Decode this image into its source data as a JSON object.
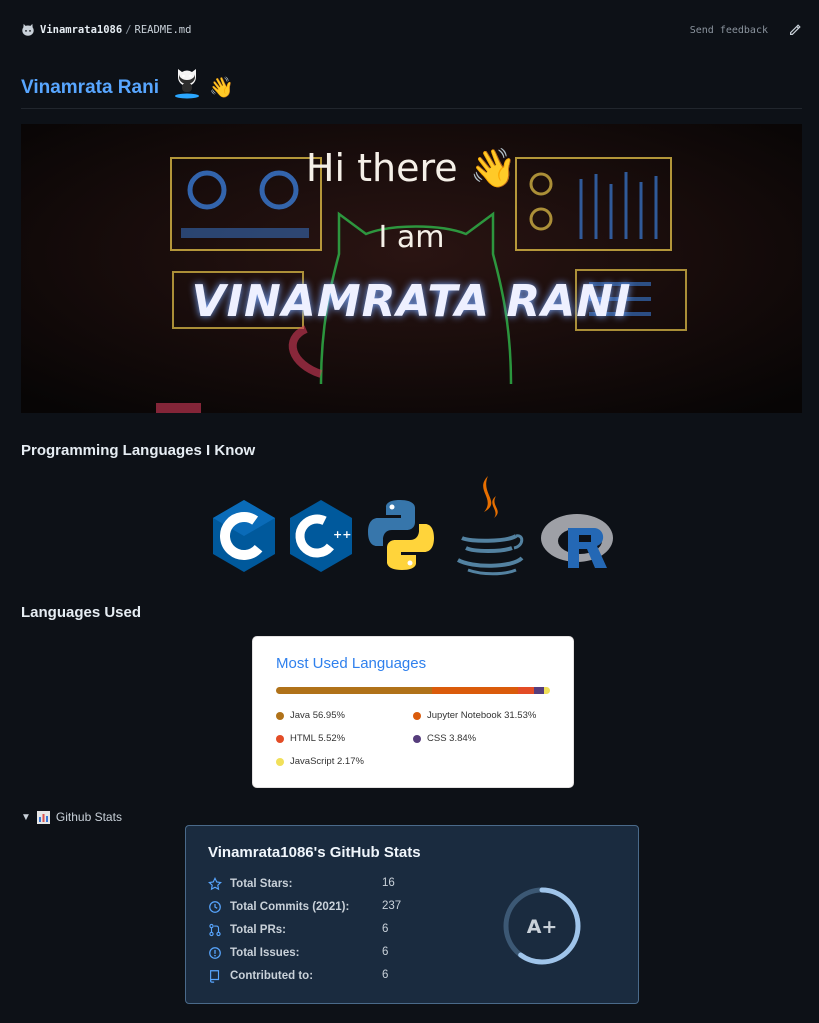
{
  "breadcrumb": {
    "repo": "Vinamrata1086",
    "separator": "/",
    "file": "README.md"
  },
  "header": {
    "feedback": "Send feedback"
  },
  "title": {
    "name": "Vinamrata Rani",
    "wave": "👋"
  },
  "banner": {
    "line1": "Hi there 👋",
    "line2": "I am",
    "line3": "VINAMRATA RANI"
  },
  "sections": {
    "programming": "Programming Languages I Know",
    "languages_used": "Languages Used",
    "github_stats": "Github Stats"
  },
  "language_icons": [
    "c-icon",
    "cpp-icon",
    "python-icon",
    "java-icon",
    "r-icon"
  ],
  "languages_card": {
    "title": "Most Used Languages",
    "items": [
      {
        "label": "Java 56.95%",
        "percent": 56.95,
        "color": "#b07219"
      },
      {
        "label": "Jupyter Notebook 31.53%",
        "percent": 31.53,
        "color": "#da5b0b"
      },
      {
        "label": "HTML 5.52%",
        "percent": 5.52,
        "color": "#e34c26"
      },
      {
        "label": "CSS 3.84%",
        "percent": 3.84,
        "color": "#563d7c"
      },
      {
        "label": "JavaScript 2.17%",
        "percent": 2.17,
        "color": "#f1e05a"
      }
    ]
  },
  "stats_card": {
    "title": "Vinamrata1086's GitHub Stats",
    "rows": [
      {
        "label": "Total Stars:",
        "value": "16",
        "icon": "star-icon"
      },
      {
        "label": "Total Commits (2021):",
        "value": "237",
        "icon": "history-icon"
      },
      {
        "label": "Total PRs:",
        "value": "6",
        "icon": "pull-request-icon"
      },
      {
        "label": "Total Issues:",
        "value": "6",
        "icon": "issue-icon"
      },
      {
        "label": "Contributed to:",
        "value": "6",
        "icon": "repo-icon"
      }
    ],
    "grade": "A+",
    "ring_fraction": 0.6
  }
}
